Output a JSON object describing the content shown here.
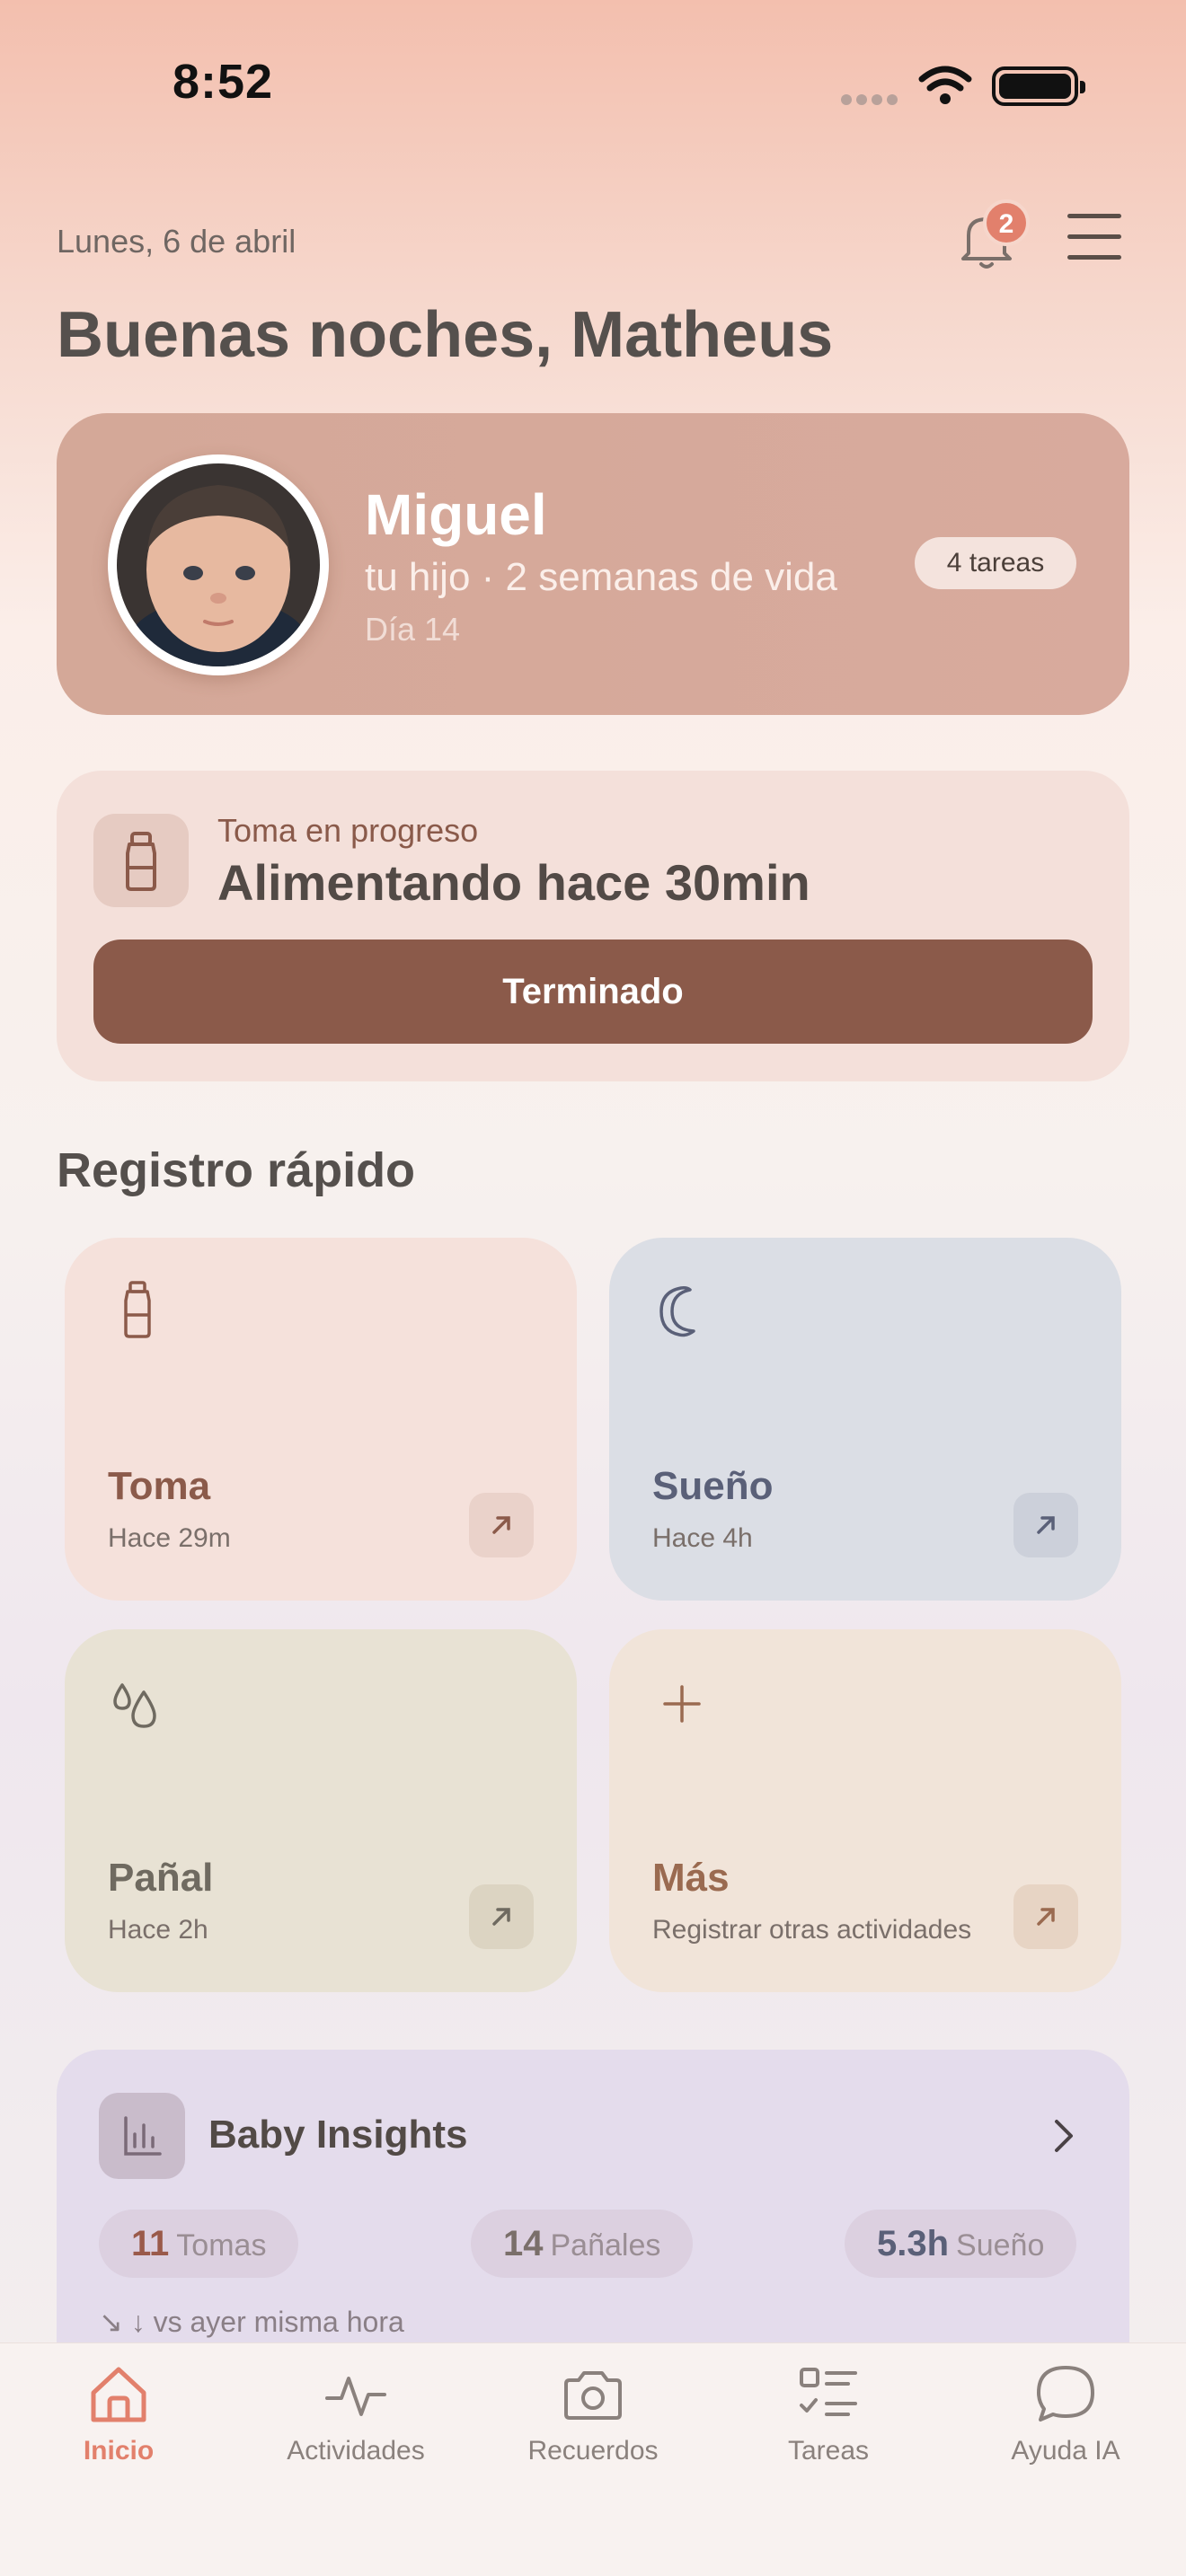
{
  "status": {
    "time": "8:52"
  },
  "header": {
    "date": "Lunes, 6 de abril",
    "notification_count": "2",
    "greeting": "Buenas noches, Matheus"
  },
  "baby": {
    "name": "Miguel",
    "subtitle": "tu hijo · 2 semanas de vida",
    "day": "Día 14",
    "tasks_badge": "4 tareas"
  },
  "feeding": {
    "label": "Toma en progreso",
    "title": "Alimentando hace 30min",
    "button": "Terminado"
  },
  "quick_log": {
    "title": "Registro rápido",
    "tiles": [
      {
        "title": "Toma",
        "subtitle": "Hace 29m",
        "icon": "bottle-icon",
        "bg": "#f5e1db",
        "accent": "#8b5a4a"
      },
      {
        "title": "Sueño",
        "subtitle": "Hace 4h",
        "icon": "moon-icon",
        "bg": "#dbdee5",
        "accent": "#5a6078"
      },
      {
        "title": "Pañal",
        "subtitle": "Hace 2h",
        "icon": "drops-icon",
        "bg": "#e8e2d4",
        "accent": "#6f6a60"
      },
      {
        "title": "Más",
        "subtitle": "Registrar otras actividades",
        "icon": "plus-icon",
        "bg": "#f1e4d9",
        "accent": "#9a6a50"
      }
    ]
  },
  "insights": {
    "title": "Baby Insights",
    "stats": [
      {
        "value": "11",
        "label": "Tomas",
        "color": "#9a5a4a"
      },
      {
        "value": "14",
        "label": "Pañales",
        "color": "#7a6f6a"
      },
      {
        "value": "5.3h",
        "label": "Sueño",
        "color": "#5a6078"
      }
    ],
    "note": "vs ayer misma hora"
  },
  "nav": {
    "items": [
      {
        "label": "Inicio",
        "icon": "home-icon",
        "active": true
      },
      {
        "label": "Actividades",
        "icon": "activity-icon",
        "active": false
      },
      {
        "label": "Recuerdos",
        "icon": "camera-icon",
        "active": false
      },
      {
        "label": "Tareas",
        "icon": "checklist-icon",
        "active": false
      },
      {
        "label": "Ayuda IA",
        "icon": "chat-bubble-icon",
        "active": false
      }
    ]
  },
  "colors": {
    "accent": "#e2806c",
    "brown": "#8b5a4a"
  }
}
